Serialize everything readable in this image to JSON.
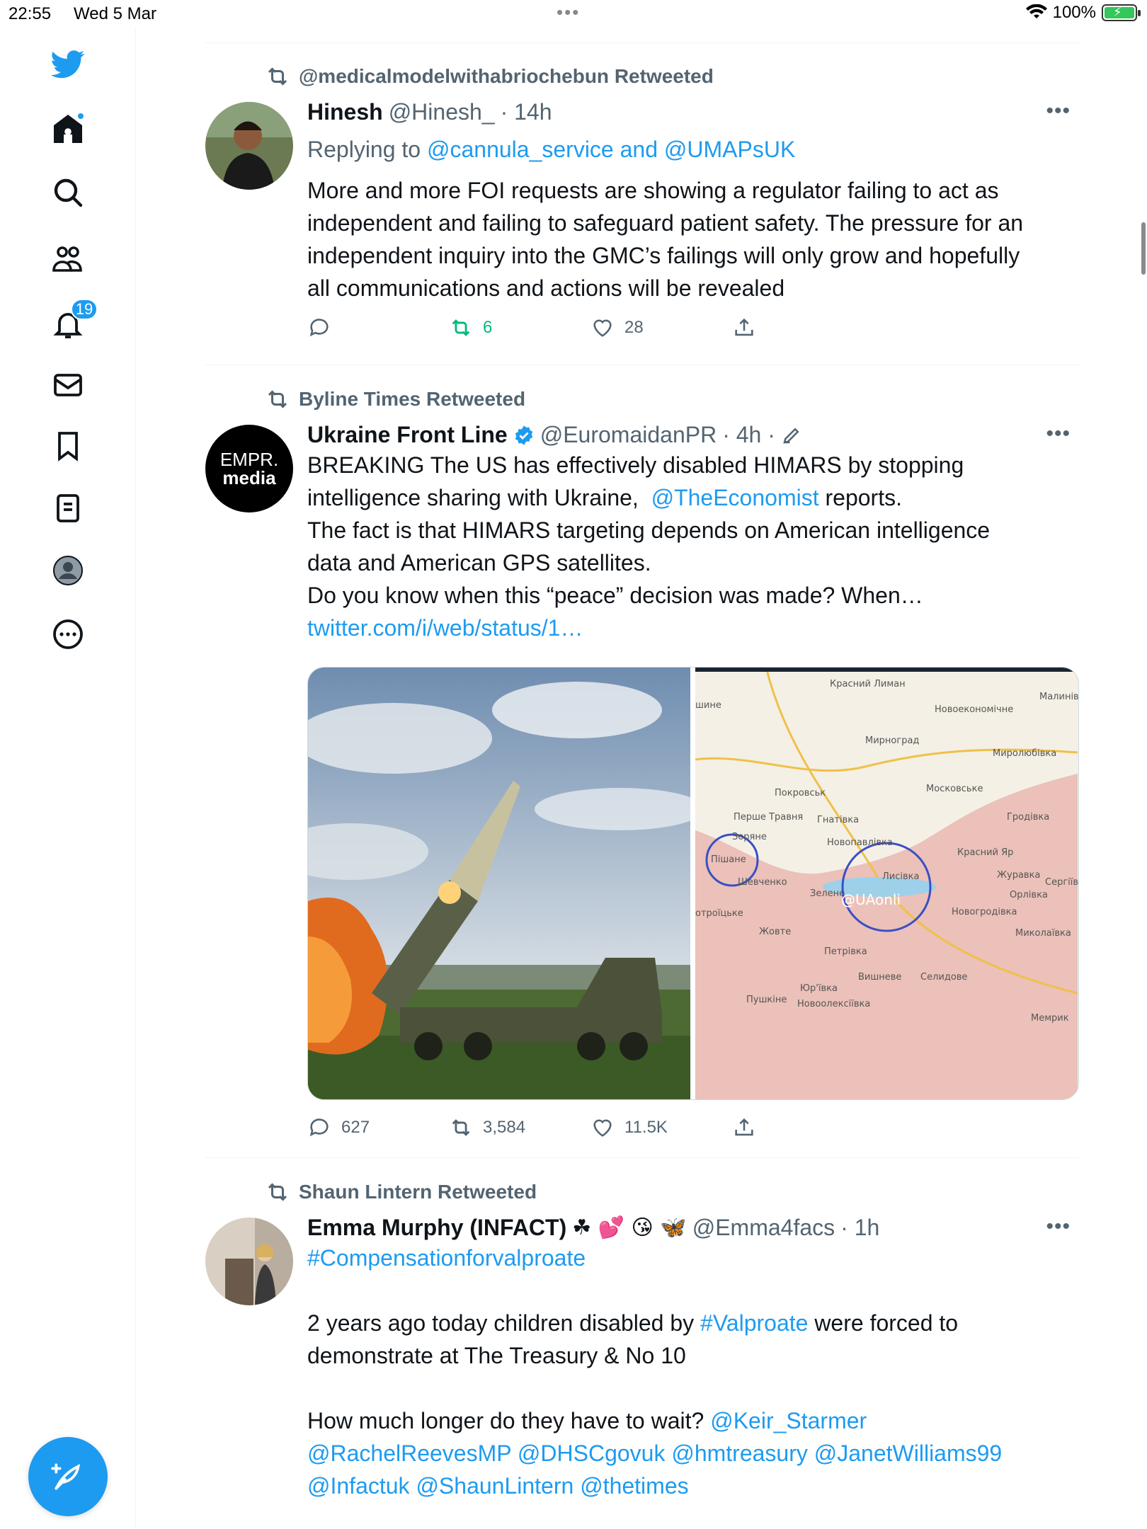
{
  "status_bar": {
    "time": "22:55",
    "date": "Wed 5 Mar",
    "battery": "100%"
  },
  "sidebar": {
    "notifications_badge": "19"
  },
  "tweets": [
    {
      "retweeted_by": "@medicalmodelwithabriochebun Retweeted",
      "name": "Hinesh",
      "handle": "@Hinesh_",
      "time": "· 14h",
      "replying_prefix": "Replying to",
      "replying_to": "@cannula_service and @UMAPsUK",
      "text_lines": [
        "More and more FOI requests are showing a regulator failing to act as",
        "independent and failing to safeguard patient safety. The pressure for an",
        "independent inquiry into the GMC’s failings will only grow and hopefully",
        "all communications and actions will be revealed"
      ],
      "replies": "",
      "retweets": "6",
      "likes": "28"
    },
    {
      "retweeted_by": "Byline Times Retweeted",
      "name": "Ukraine Front Line",
      "handle": "@EuromaidanPR",
      "time": "· 4h ·",
      "avatar_text_1": "EMPR.",
      "avatar_text_2": "media",
      "text_line1": "BREAKING The US has effectively disabled HIMARS by stopping",
      "text_line2_pre": "intelligence sharing with Ukraine,",
      "text_line2_link": "@TheEconomist",
      "text_line2_post": "reports.",
      "text_line3": "The fact is that HIMARS targeting depends on American intelligence",
      "text_line4": "data and American GPS satellites.",
      "text_line5": "Do you know when this “peace” decision was made? When…",
      "text_link": "twitter.com/i/web/status/1…",
      "map_labels": {
        "l1": "Красний Лиман",
        "l2": "Новоекономічне",
        "l3": "Мирноград",
        "l4": "Миролюбівка",
        "l5": "Покровськ",
        "l6": "Московське",
        "l7": "Перше Травня",
        "l8": "Гнатівка",
        "l9": "Гродівка",
        "l10": "Новопавлівка",
        "l11": "Красний Яр",
        "l12": "Пішане",
        "l13": "Шевченко",
        "l14": "Лисівка",
        "l15": "Журавка",
        "l16": "Сергіїв",
        "l17": "Орлівка",
        "l18": "Зелене",
        "l19": "Новогродівка",
        "l20": "Жовте",
        "l21": "Миколаївка",
        "l22": "Петрівка",
        "l23": "Вишневе",
        "l24": "Селидове",
        "l25": "Юр'ївка",
        "l26": "Пушкіне",
        "l27": "Новоолексіївка",
        "l28": "Мемрик",
        "l29": "@UAonli",
        "l30": "Малинів",
        "l31": "шине",
        "l32": "Зоряне",
        "l33": "отроїцьке"
      },
      "replies": "627",
      "retweets": "3,584",
      "likes": "11.5K"
    },
    {
      "retweeted_by": "Shaun Lintern Retweeted",
      "name": "Emma Murphy (INFACT)",
      "name_emojis": "☘ 💕 😘 🦋",
      "handle": "@Emma4facs",
      "time": "· 1h",
      "hashtag": "#Compensationforvalproate",
      "line2_pre": "2 years ago today children disabled by",
      "line2_link": "#Valproate",
      "line2_post": "were forced to",
      "line3": "demonstrate at The Treasury & No 10",
      "line4_pre": "How much longer do they have to wait?",
      "line4_link": "@Keir_Starmer",
      "line5": "@RachelReevesMP @DHSCgovuk @hmtreasury @JanetWilliams99",
      "line6": "@Infactuk @ShaunLintern @thetimes"
    }
  ],
  "colors": {
    "accent": "#1d9bf0",
    "retweet_green": "#00ba7c",
    "muted": "#536471"
  }
}
